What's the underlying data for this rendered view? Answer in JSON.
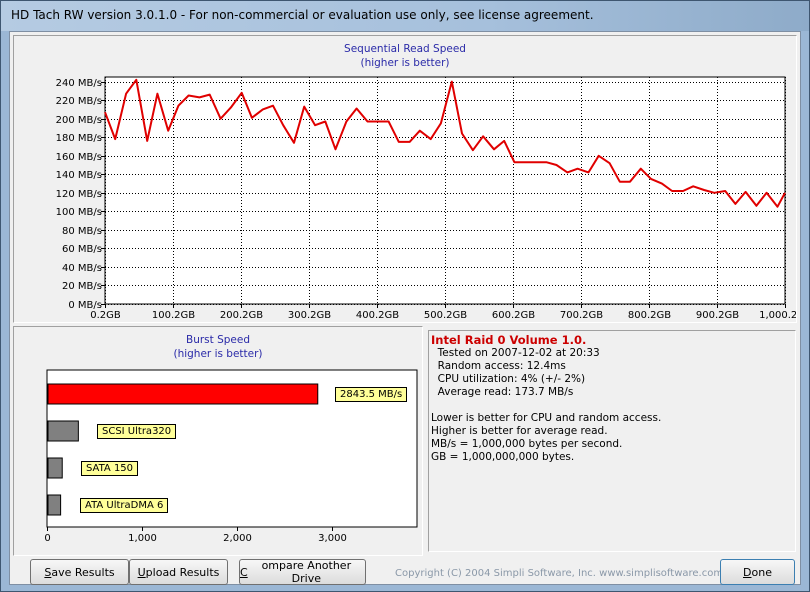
{
  "window": {
    "title": "HD Tach RW version 3.0.1.0  - For non-commercial or evaluation use only, see license agreement."
  },
  "sequential": {
    "title": "Sequential Read Speed",
    "subtitle": "(higher is better)"
  },
  "burst": {
    "title": "Burst Speed",
    "subtitle": "(higher is better)"
  },
  "chart_data": [
    {
      "type": "line",
      "title": "Sequential Read Speed",
      "subtitle": "(higher is better)",
      "xlabel": "",
      "ylabel": "",
      "xlim": [
        0,
        1000
      ],
      "ylim": [
        0,
        245
      ],
      "x_tick_labels": [
        "0.2GB",
        "100.2GB",
        "200.2GB",
        "300.2GB",
        "400.2GB",
        "500.2GB",
        "600.2GB",
        "700.2GB",
        "800.2GB",
        "900.2GB",
        "1,000.2GB"
      ],
      "x_ticks": [
        0,
        100,
        200,
        300,
        400,
        500,
        600,
        700,
        800,
        900,
        1000
      ],
      "y_tick_labels": [
        "0 MB/s",
        "20 MB/s",
        "40 MB/s",
        "60 MB/s",
        "80 MB/s",
        "100 MB/s",
        "120 MB/s",
        "140 MB/s",
        "160 MB/s",
        "180 MB/s",
        "200 MB/s",
        "220 MB/s",
        "240 MB/s"
      ],
      "y_ticks": [
        0,
        20,
        40,
        60,
        80,
        100,
        120,
        140,
        160,
        180,
        200,
        220,
        240
      ],
      "grid": true,
      "series_color": "#e00000",
      "x": [
        0,
        15,
        31,
        46,
        62,
        77,
        93,
        108,
        123,
        139,
        154,
        170,
        185,
        201,
        216,
        232,
        247,
        262,
        278,
        293,
        309,
        324,
        339,
        355,
        370,
        386,
        401,
        417,
        432,
        448,
        463,
        479,
        494,
        510,
        525,
        541,
        556,
        572,
        587,
        602,
        618,
        633,
        649,
        664,
        680,
        695,
        711,
        726,
        742,
        757,
        772,
        788,
        803,
        819,
        834,
        850,
        865,
        881,
        896,
        912,
        927,
        942,
        958,
        973,
        989,
        1000
      ],
      "y": [
        207,
        178,
        227,
        242,
        176,
        227,
        187,
        214,
        225,
        223,
        226,
        200,
        212,
        228,
        201,
        210,
        214,
        193,
        174,
        213,
        193,
        197,
        167,
        197,
        211,
        197,
        197,
        197,
        175,
        175,
        187,
        178,
        195,
        240,
        184,
        166,
        181,
        167,
        176,
        153,
        153,
        153,
        153,
        150,
        142,
        146,
        142,
        160,
        152,
        132,
        132,
        146,
        135,
        130,
        122,
        122,
        127,
        123,
        120,
        122,
        108,
        121,
        106,
        120,
        105,
        120
      ]
    },
    {
      "type": "bar",
      "orientation": "horizontal",
      "title": "Burst Speed",
      "subtitle": "(higher is better)",
      "categories": [
        "Intel Raid 0 Volume 1.0.",
        "SCSI Ultra320",
        "SATA 150",
        "ATA UltraDMA 6"
      ],
      "values": [
        2843.5,
        320,
        150,
        133
      ],
      "value_label": "2843.5 MB/s",
      "bar_labels": [
        "2843.5 MB/s",
        "SCSI Ultra320",
        "SATA 150",
        "ATA UltraDMA 6"
      ],
      "bar_colors": [
        "#ff0000",
        "#808080",
        "#808080",
        "#808080"
      ],
      "xlim": [
        0,
        3900
      ],
      "x_ticks": [
        0,
        1000,
        2000,
        3000
      ],
      "x_tick_labels": [
        "0",
        "1,000",
        "2,000",
        "3,000"
      ],
      "grid": false
    }
  ],
  "info": {
    "heading": "Intel Raid 0 Volume 1.0.",
    "lines": [
      "  Tested on 2007-12-02 at 20:33",
      "  Random access: 12.4ms",
      "  CPU utilization: 4% (+/- 2%)",
      "  Average read: 173.7 MB/s"
    ],
    "notes": [
      "Lower is better for CPU and random access.",
      "Higher is better for average read.",
      "MB/s = 1,000,000 bytes per second.",
      "GB = 1,000,000,000 bytes."
    ]
  },
  "buttons": {
    "save": {
      "mnemonic": "S",
      "rest": "ave Results"
    },
    "upload": {
      "mnemonic": "U",
      "rest": "pload Results"
    },
    "compare": {
      "mnemonic": "C",
      "rest": "ompare Another Drive"
    },
    "done": {
      "mnemonic": "D",
      "rest": "one"
    }
  },
  "copyright": "Copyright (C) 2004 Simpli Software, Inc. www.simplisoftware.com"
}
